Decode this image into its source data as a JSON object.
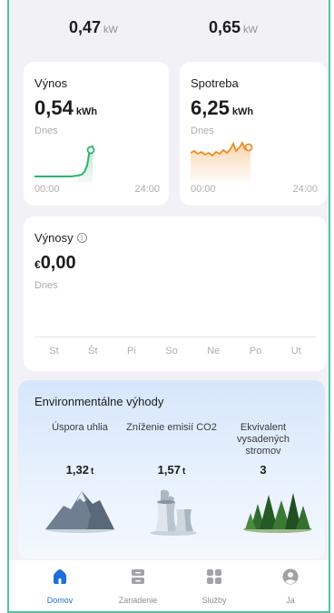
{
  "top": {
    "left_value": "0,47",
    "left_unit": "kW",
    "right_value": "0,65",
    "right_unit": "kW"
  },
  "yield_card": {
    "title": "Výnos",
    "value": "0,54",
    "unit": "kWh",
    "sub": "Dnes",
    "axis_start": "00:00",
    "axis_end": "24:00",
    "color": "#2db36c"
  },
  "consumption_card": {
    "title": "Spotreba",
    "value": "6,25",
    "unit": "kWh",
    "sub": "Dnes",
    "axis_start": "00:00",
    "axis_end": "24:00",
    "color": "#f28a1e"
  },
  "revenue_card": {
    "title": "Výnosy",
    "currency": "€",
    "value": "0,00",
    "sub": "Dnes",
    "days": [
      "St",
      "Št",
      "Pi",
      "So",
      "Ne",
      "Po",
      "Ut"
    ]
  },
  "environment": {
    "title": "Environmentálne výhody",
    "items": [
      {
        "label": "Úspora uhlia",
        "value": "1,32",
        "unit": "t",
        "icon": "coal-mountain-icon"
      },
      {
        "label": "Zníženie emisií CO2",
        "value": "1,57",
        "unit": "t",
        "icon": "cooling-tower-icon"
      },
      {
        "label": "Ekvivalent vysadených stromov",
        "value": "3",
        "unit": "",
        "icon": "forest-icon"
      }
    ]
  },
  "tabbar": {
    "active_color": "#1e6fd9",
    "tabs": [
      {
        "label": "Domov",
        "icon": "home-icon",
        "active": true
      },
      {
        "label": "Zariadenie",
        "icon": "device-icon",
        "active": false
      },
      {
        "label": "Služby",
        "icon": "services-grid-icon",
        "active": false
      },
      {
        "label": "Ja",
        "icon": "profile-icon",
        "active": false
      }
    ]
  }
}
